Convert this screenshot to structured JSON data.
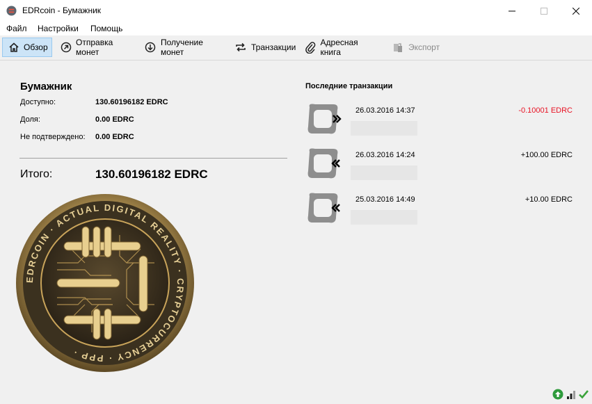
{
  "window": {
    "title": "EDRcoin - Бумажник"
  },
  "menu": {
    "items": [
      "Файл",
      "Настройки",
      "Помощь"
    ]
  },
  "toolbar": {
    "overview": "Обзор",
    "send": "Отправка монет",
    "receive": "Получение монет",
    "transactions": "Транзакции",
    "address_book": "Адресная книга",
    "export": "Экспорт"
  },
  "wallet": {
    "title": "Бумажник",
    "available_label": "Доступно:",
    "available_value": "130.60196182 EDRC",
    "stake_label": "Доля:",
    "stake_value": "0.00 EDRC",
    "unconfirmed_label": "Не подтверждено:",
    "unconfirmed_value": "0.00 EDRC",
    "total_label": "Итого:",
    "total_value": "130.60196182 EDRC"
  },
  "coin": {
    "ring_text": "EDRCOIN · ACTUAL DIGITAL REALITY · CRYPTOCURRENCY · PPP ·"
  },
  "recent": {
    "title": "Последние транзакции",
    "items": [
      {
        "date": "26.03.2016 14:37",
        "amount": "-0.10001 EDRC",
        "direction": "outgoing",
        "color": "#e81123"
      },
      {
        "date": "26.03.2016 14:24",
        "amount": "+100.00 EDRC",
        "direction": "incoming",
        "color": "#000000"
      },
      {
        "date": "25.03.2016 14:49",
        "amount": "+10.00 EDRC",
        "direction": "incoming",
        "color": "#000000"
      }
    ]
  },
  "colors": {
    "active_tab_bg": "#cce4f7",
    "negative_amount": "#e81123",
    "coin_gold": "#c9a45a"
  },
  "icons": {
    "app": "edrcoin-logo-icon",
    "status": [
      "sync-icon",
      "signal-bars-icon",
      "checkmark-icon"
    ]
  }
}
